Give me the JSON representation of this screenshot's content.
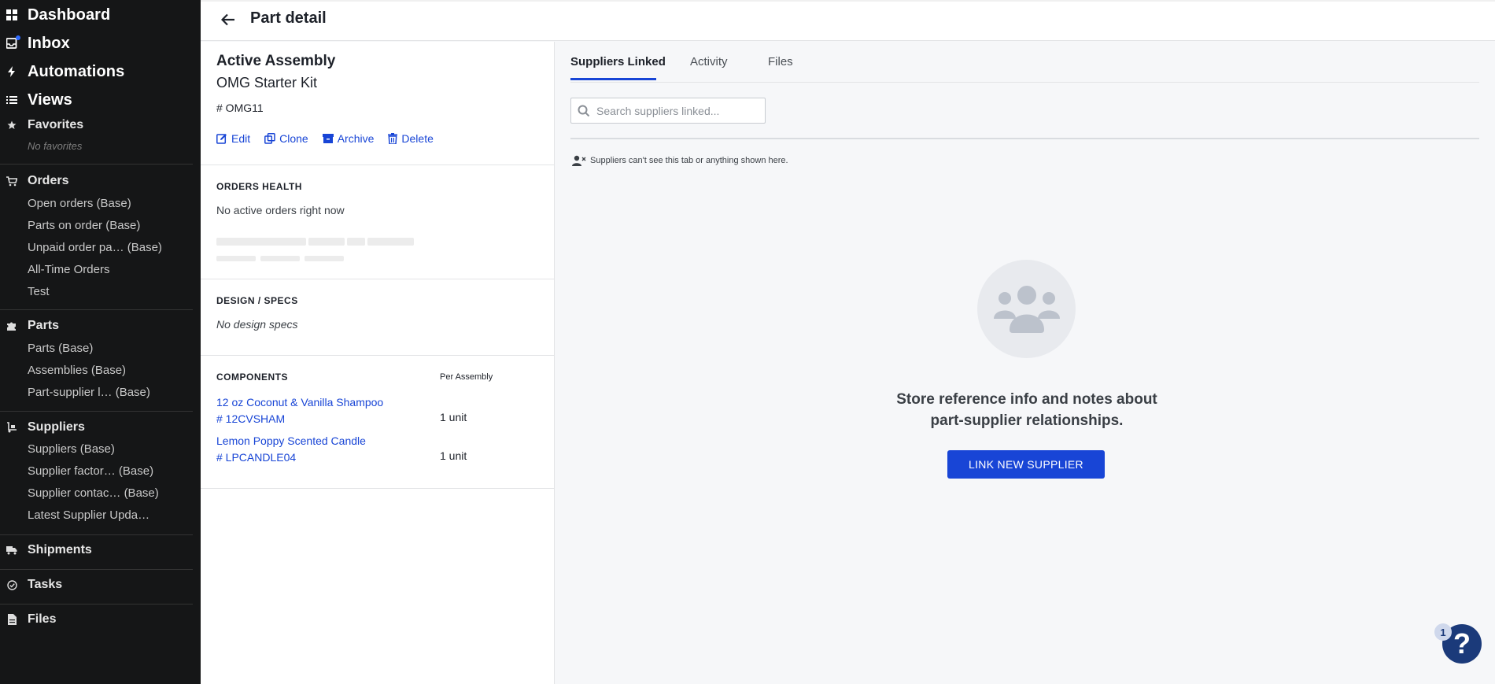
{
  "sidebar": {
    "top": [
      {
        "label": "Dashboard",
        "icon": "dashboard-icon"
      },
      {
        "label": "Inbox",
        "icon": "inbox-icon"
      },
      {
        "label": "Automations",
        "icon": "bolt-icon"
      },
      {
        "label": "Views",
        "icon": "list-icon"
      }
    ],
    "favorites": {
      "label": "Favorites",
      "empty": "No favorites"
    },
    "orders": {
      "label": "Orders",
      "items": [
        "Open orders (Base)",
        "Parts on order (Base)",
        "Unpaid order pa… (Base)",
        "All-Time Orders",
        "Test"
      ]
    },
    "parts": {
      "label": "Parts",
      "items": [
        "Parts (Base)",
        "Assemblies (Base)",
        "Part-supplier l… (Base)"
      ]
    },
    "suppliers": {
      "label": "Suppliers",
      "items": [
        "Suppliers (Base)",
        "Supplier factor… (Base)",
        "Supplier contac… (Base)",
        "Latest Supplier Upda…"
      ]
    },
    "bottom": [
      {
        "label": "Shipments",
        "icon": "truck-icon"
      },
      {
        "label": "Tasks",
        "icon": "check-circle-icon"
      },
      {
        "label": "Files",
        "icon": "file-icon"
      }
    ]
  },
  "header": {
    "title": "Part detail"
  },
  "part": {
    "kind": "Active Assembly",
    "name": "OMG Starter Kit",
    "number": "# OMG11",
    "actions": {
      "edit": "Edit",
      "clone": "Clone",
      "archive": "Archive",
      "delete": "Delete"
    }
  },
  "orders_health": {
    "title": "ORDERS HEALTH",
    "status": "No active orders right now"
  },
  "design_specs": {
    "title": "DESIGN / SPECS",
    "empty": "No design specs"
  },
  "components": {
    "title": "COMPONENTS",
    "per_assembly_label": "Per Assembly",
    "items": [
      {
        "name": "12 oz Coconut & Vanilla Shampoo",
        "number": "# 12CVSHAM",
        "qty": "1 unit"
      },
      {
        "name": "Lemon Poppy Scented Candle",
        "number": "# LPCANDLE04",
        "qty": "1 unit"
      }
    ]
  },
  "tabs": {
    "suppliers_linked": "Suppliers Linked",
    "activity": "Activity",
    "files": "Files"
  },
  "search": {
    "placeholder": "Search suppliers linked...",
    "value": ""
  },
  "notice": "Suppliers can't see this tab or anything shown here.",
  "empty_state": {
    "line1": "Store reference info and notes about",
    "line2": "part-supplier relationships.",
    "button": "LINK NEW SUPPLIER"
  },
  "help": {
    "label": "?",
    "badge": "1"
  },
  "colors": {
    "accent": "#1845d6",
    "sidebar_bg": "#151617",
    "inbox_dot": "#2f6bff"
  }
}
